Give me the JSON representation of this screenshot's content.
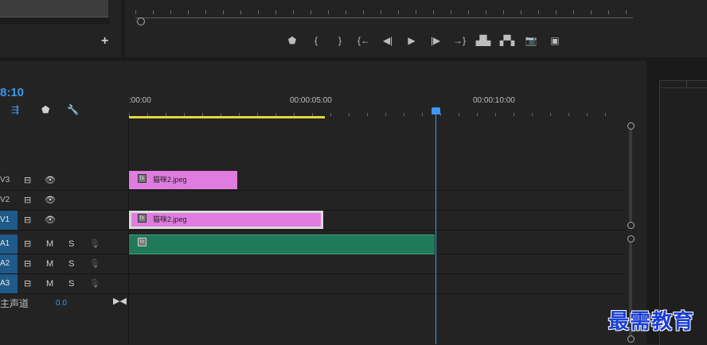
{
  "source_monitor": {
    "add_label": "+"
  },
  "transport": {
    "buttons": [
      {
        "name": "add-marker-button",
        "glyph": "⬟"
      },
      {
        "name": "mark-in-button",
        "glyph": "{"
      },
      {
        "name": "mark-out-button",
        "glyph": "}"
      },
      {
        "name": "go-to-in-button",
        "glyph": "{←"
      },
      {
        "name": "step-back-button",
        "glyph": "◀|"
      },
      {
        "name": "play-button",
        "glyph": "▶"
      },
      {
        "name": "step-forward-button",
        "glyph": "|▶"
      },
      {
        "name": "go-to-out-button",
        "glyph": "→}"
      },
      {
        "name": "lift-button",
        "glyph": "▟▙"
      },
      {
        "name": "extract-button",
        "glyph": "▞▚"
      },
      {
        "name": "export-frame-button",
        "glyph": "📷"
      },
      {
        "name": "compare-view-button",
        "glyph": "▣"
      }
    ]
  },
  "timeline": {
    "timecode": "8:10",
    "ruler_labels": [
      ":00:00",
      "00:00:05:00",
      "00:00:10:00"
    ],
    "tracks": [
      {
        "id": "v3",
        "label": "V3",
        "type": "video",
        "targeted": false
      },
      {
        "id": "v2",
        "label": "V2",
        "type": "video",
        "targeted": false
      },
      {
        "id": "v1",
        "label": "V1",
        "type": "video",
        "targeted": true
      },
      {
        "id": "a1",
        "label": "A1",
        "type": "audio",
        "targeted": true,
        "m": "M",
        "s": "S"
      },
      {
        "id": "a2",
        "label": "A2",
        "type": "audio",
        "targeted": true,
        "m": "M",
        "s": "S"
      },
      {
        "id": "a3",
        "label": "A3",
        "type": "audio",
        "targeted": true,
        "m": "M",
        "s": "S"
      }
    ],
    "clips": {
      "v3_clip": {
        "name": "猫咪2.jpeg",
        "fx": "fx"
      },
      "v1_clip": {
        "name": "猫咪2.jpeg",
        "fx": "fx"
      },
      "a1_fx": "fx"
    },
    "master": {
      "label": "主声道",
      "value": "0.0"
    }
  },
  "watermark": "最需教育"
}
